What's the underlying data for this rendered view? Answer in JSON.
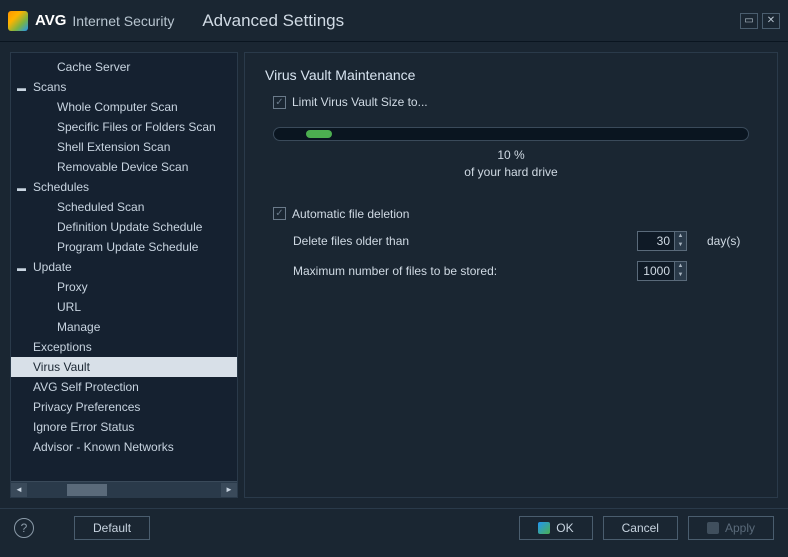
{
  "titlebar": {
    "brand": "AVG",
    "product": "Internet Security",
    "title": "Advanced Settings"
  },
  "sidebar": {
    "items": [
      {
        "label": "Cache Server",
        "level": "child"
      },
      {
        "label": "Scans",
        "level": "parent",
        "expand": "▬"
      },
      {
        "label": "Whole Computer Scan",
        "level": "child"
      },
      {
        "label": "Specific Files or Folders Scan",
        "level": "child"
      },
      {
        "label": "Shell Extension Scan",
        "level": "child"
      },
      {
        "label": "Removable Device Scan",
        "level": "child"
      },
      {
        "label": "Schedules",
        "level": "parent",
        "expand": "▬"
      },
      {
        "label": "Scheduled Scan",
        "level": "child"
      },
      {
        "label": "Definition Update Schedule",
        "level": "child"
      },
      {
        "label": "Program Update Schedule",
        "level": "child"
      },
      {
        "label": "Update",
        "level": "parent",
        "expand": "▬"
      },
      {
        "label": "Proxy",
        "level": "child"
      },
      {
        "label": "URL",
        "level": "child"
      },
      {
        "label": "Manage",
        "level": "child"
      },
      {
        "label": "Exceptions",
        "level": "top"
      },
      {
        "label": "Virus Vault",
        "level": "top",
        "selected": true
      },
      {
        "label": "AVG Self Protection",
        "level": "top"
      },
      {
        "label": "Privacy Preferences",
        "level": "top"
      },
      {
        "label": "Ignore Error Status",
        "level": "top"
      },
      {
        "label": "Advisor - Known Networks",
        "level": "top"
      }
    ]
  },
  "main": {
    "title": "Virus Vault Maintenance",
    "limit_label": "Limit Virus Vault Size to...",
    "slider_percent": "10 %",
    "slider_sub": "of your hard drive",
    "auto_delete_label": "Automatic file deletion",
    "delete_older_label": "Delete files older than",
    "delete_older_value": "30",
    "delete_older_unit": "day(s)",
    "max_files_label": "Maximum number of files to be stored:",
    "max_files_value": "1000"
  },
  "footer": {
    "default": "Default",
    "ok": "OK",
    "cancel": "Cancel",
    "apply": "Apply"
  }
}
